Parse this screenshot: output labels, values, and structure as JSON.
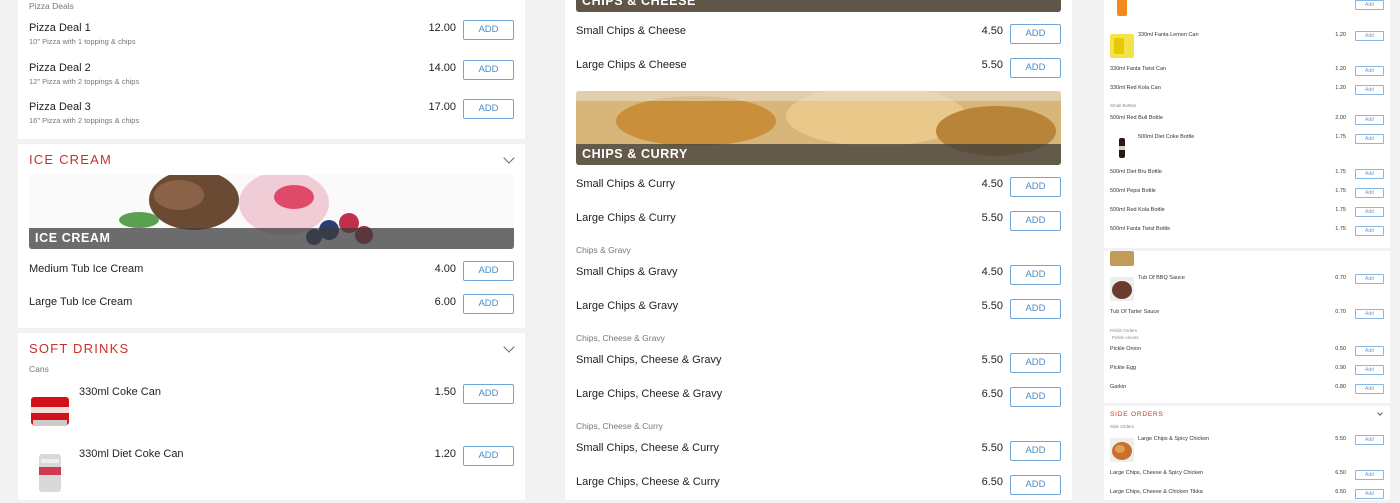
{
  "col1": {
    "pizza_deals": {
      "subheading": "Pizza Deals",
      "items": [
        {
          "name": "Pizza Deal 1",
          "desc": "10\" Pizza with 1 topping & chips",
          "price": "12.00",
          "add": "ADD"
        },
        {
          "name": "Pizza Deal 2",
          "desc": "12\" Pizza with 2 toppings & chips",
          "price": "14.00",
          "add": "ADD"
        },
        {
          "name": "Pizza Deal 3",
          "desc": "16\" Pizza with 2 toppings & chips",
          "price": "17.00",
          "add": "ADD"
        }
      ]
    },
    "ice_cream": {
      "title": "ICE CREAM",
      "banner": "ICE CREAM",
      "items": [
        {
          "name": "Medium Tub Ice Cream",
          "price": "4.00",
          "add": "ADD"
        },
        {
          "name": "Large Tub Ice Cream",
          "price": "6.00",
          "add": "ADD"
        }
      ]
    },
    "soft_drinks": {
      "title": "SOFT DRINKS",
      "subheading": "Cans",
      "items": [
        {
          "name": "330ml Coke Can",
          "price": "1.50",
          "add": "ADD"
        },
        {
          "name": "330ml Diet Coke Can",
          "price": "1.20",
          "add": "ADD"
        }
      ]
    }
  },
  "col2": {
    "top_banner": "CHIPS & CHEESE",
    "chips_cheese": [
      {
        "name": "Small Chips & Cheese",
        "price": "4.50",
        "add": "ADD"
      },
      {
        "name": "Large Chips & Cheese",
        "price": "5.50",
        "add": "ADD"
      }
    ],
    "curry_banner": "CHIPS & CURRY",
    "chips_curry": [
      {
        "name": "Small Chips & Curry",
        "price": "4.50",
        "add": "ADD"
      },
      {
        "name": "Large Chips & Curry",
        "price": "5.50",
        "add": "ADD"
      }
    ],
    "gravy_sub": "Chips & Gravy",
    "chips_gravy": [
      {
        "name": "Small Chips & Gravy",
        "price": "4.50",
        "add": "ADD"
      },
      {
        "name": "Large Chips & Gravy",
        "price": "5.50",
        "add": "ADD"
      }
    ],
    "cheese_gravy_sub": "Chips, Cheese & Gravy",
    "chips_cheese_gravy": [
      {
        "name": "Small Chips, Cheese & Gravy",
        "price": "5.50",
        "add": "ADD"
      },
      {
        "name": "Large Chips, Cheese & Gravy",
        "price": "6.50",
        "add": "ADD"
      }
    ],
    "cheese_curry_sub": "Chips, Cheese & Curry",
    "chips_cheese_curry": [
      {
        "name": "Small Chips, Cheese & Curry",
        "price": "5.50",
        "add": "ADD"
      },
      {
        "name": "Large Chips, Cheese & Curry",
        "price": "6.50",
        "add": "ADD"
      }
    ]
  },
  "col3": {
    "add": "Add",
    "drinks": [
      {
        "name": "330ml Fanta Lemon Can",
        "price": "1.20"
      },
      {
        "name": "330ml Fanta Twist Can",
        "price": "1.20"
      },
      {
        "name": "330ml Red Kola Can",
        "price": "1.20"
      }
    ],
    "small_bottles_sub": "Small Bottles",
    "bottles": [
      {
        "name": "500ml Red Bull Bottle",
        "price": "2.00"
      },
      {
        "name": "500ml Diet Coke Bottle",
        "price": "1.75"
      },
      {
        "name": "500ml Diet Bru Bottle",
        "price": "1.75"
      },
      {
        "name": "500ml Pepsi Bottle",
        "price": "1.75"
      },
      {
        "name": "500ml Red Kola Bottle",
        "price": "1.75"
      },
      {
        "name": "500ml Fanta Twist Bottle",
        "price": "1.75"
      }
    ],
    "sauces": [
      {
        "name": "Tub Of BBQ Sauce",
        "price": "0.70"
      },
      {
        "name": "Tub Of Tarter Sauce",
        "price": "0.70"
      }
    ],
    "pickle_sub": "Pickle Orders",
    "pickle_sub2": "Pickle onions",
    "pickles": [
      {
        "name": "Pickle Onion",
        "price": "0.50"
      },
      {
        "name": "Pickle Egg",
        "price": "0.90"
      },
      {
        "name": "Garkin",
        "price": "0.80"
      }
    ],
    "side_title": "SIDE ORDERS",
    "side_sub": "Side Orders",
    "sides": [
      {
        "name": "Large Chips & Spicy Chicken",
        "price": "5.50"
      },
      {
        "name": "Large Chips, Cheese & Spicy Chicken",
        "price": "6.50"
      },
      {
        "name": "Large Chips, Cheese & Chicken Tikka",
        "price": "6.50"
      }
    ]
  },
  "colors": {
    "accent_red": "#c9302c",
    "button_blue": "#4a8cc7"
  }
}
